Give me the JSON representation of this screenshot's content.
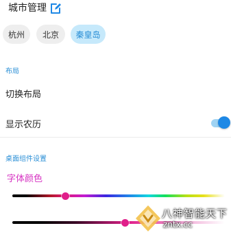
{
  "header": {
    "title": "城市管理",
    "edit_icon": "pencil-edit-icon"
  },
  "cities": [
    {
      "label": "杭州",
      "selected": false
    },
    {
      "label": "北京",
      "selected": false
    },
    {
      "label": "秦皇岛",
      "selected": true
    }
  ],
  "layout_section": {
    "label": "布局",
    "switch_layout_label": "切换布局",
    "show_lunar_label": "显示农历",
    "show_lunar_on": true
  },
  "widget_section": {
    "label": "桌面组件设置",
    "font_color_label": "字体颜色",
    "hue_slider_value": 0.25,
    "shade_slider_value": 0.53
  },
  "watermark": {
    "line1": "八神智能天下",
    "line2": "zntx.cc"
  },
  "colors": {
    "accent": "#2b8fd6",
    "font_color": "#d633c2",
    "thumb": "#e01f8a"
  }
}
